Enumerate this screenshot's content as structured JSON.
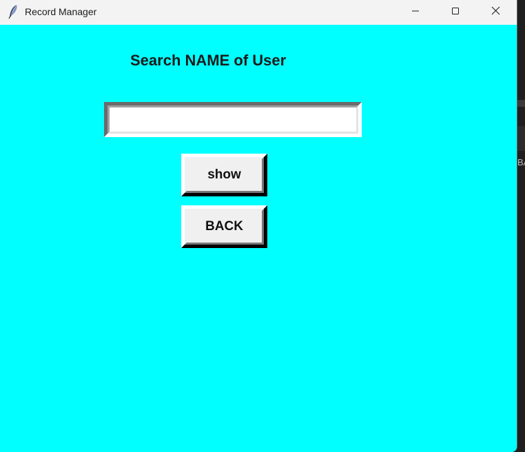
{
  "window": {
    "title": "Record Manager",
    "background_color": "#00ffff",
    "icon": "feather-icon",
    "controls": {
      "minimize_icon": "minimize-icon",
      "maximize_icon": "maximize-icon",
      "close_icon": "close-icon"
    }
  },
  "form": {
    "heading": "Search NAME of User",
    "name_input": {
      "value": "",
      "placeholder": ""
    },
    "show_button_label": "show",
    "back_button_label": "BACK"
  },
  "background_window": {
    "partial_text": "BA"
  }
}
